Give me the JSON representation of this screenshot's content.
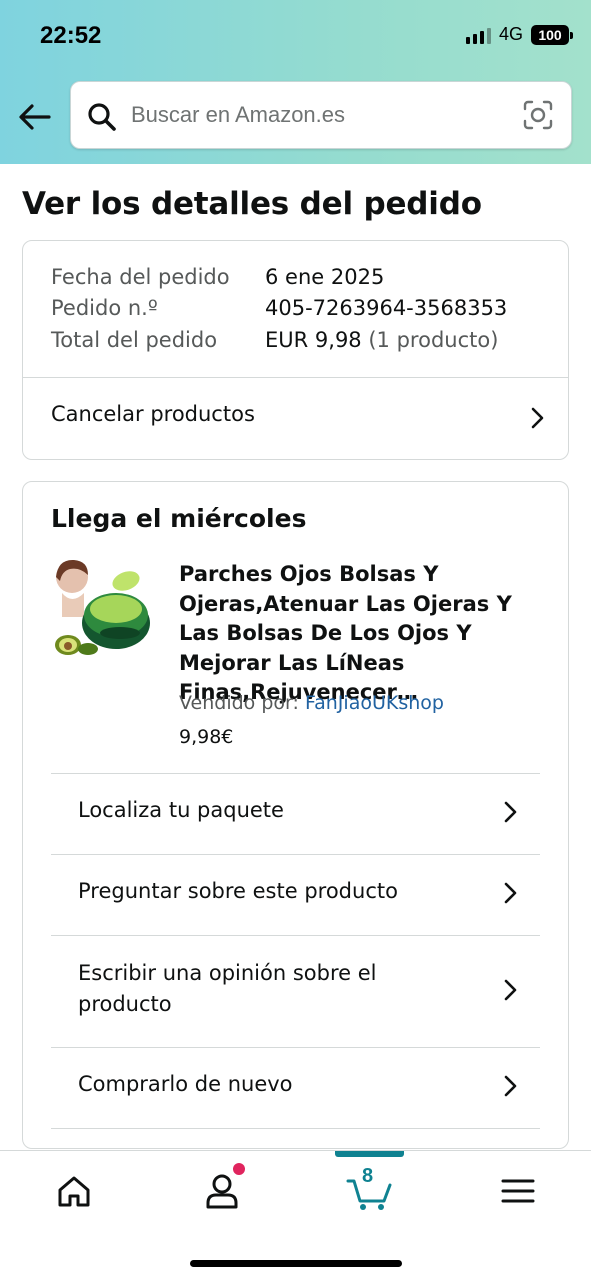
{
  "status_bar": {
    "time": "22:52",
    "network": "4G",
    "battery": "100"
  },
  "search": {
    "placeholder": "Buscar en Amazon.es"
  },
  "page": {
    "title": "Ver los detalles del pedido"
  },
  "order": {
    "date_label": "Fecha del pedido",
    "date_value": "6 ene 2025",
    "number_label": "Pedido n.º",
    "number_value": "405-7263964-3568353",
    "total_label": "Total del pedido",
    "total_value": "EUR 9,98",
    "total_count": "(1 producto)",
    "cancel_label": "Cancelar productos"
  },
  "shipment": {
    "arrival": "Llega el miércoles",
    "product_title": "Parches Ojos Bolsas Y Ojeras,Atenuar Las Ojeras Y Las Bolsas De Los Ojos Y Mejorar Las LíNeas Finas,Rejuvenecer…",
    "sold_by_label": "Vendido por:",
    "seller": "FanJiaoUKshop",
    "price": "9,98€",
    "actions": [
      "Localiza tu paquete",
      "Preguntar sobre este producto",
      "Escribir una opinión sobre el producto",
      "Comprarlo de nuevo"
    ]
  },
  "nav": {
    "cart_count": "8"
  },
  "colors": {
    "accent": "#0f8291",
    "link": "#2162a1",
    "badge": "#e0245e"
  }
}
